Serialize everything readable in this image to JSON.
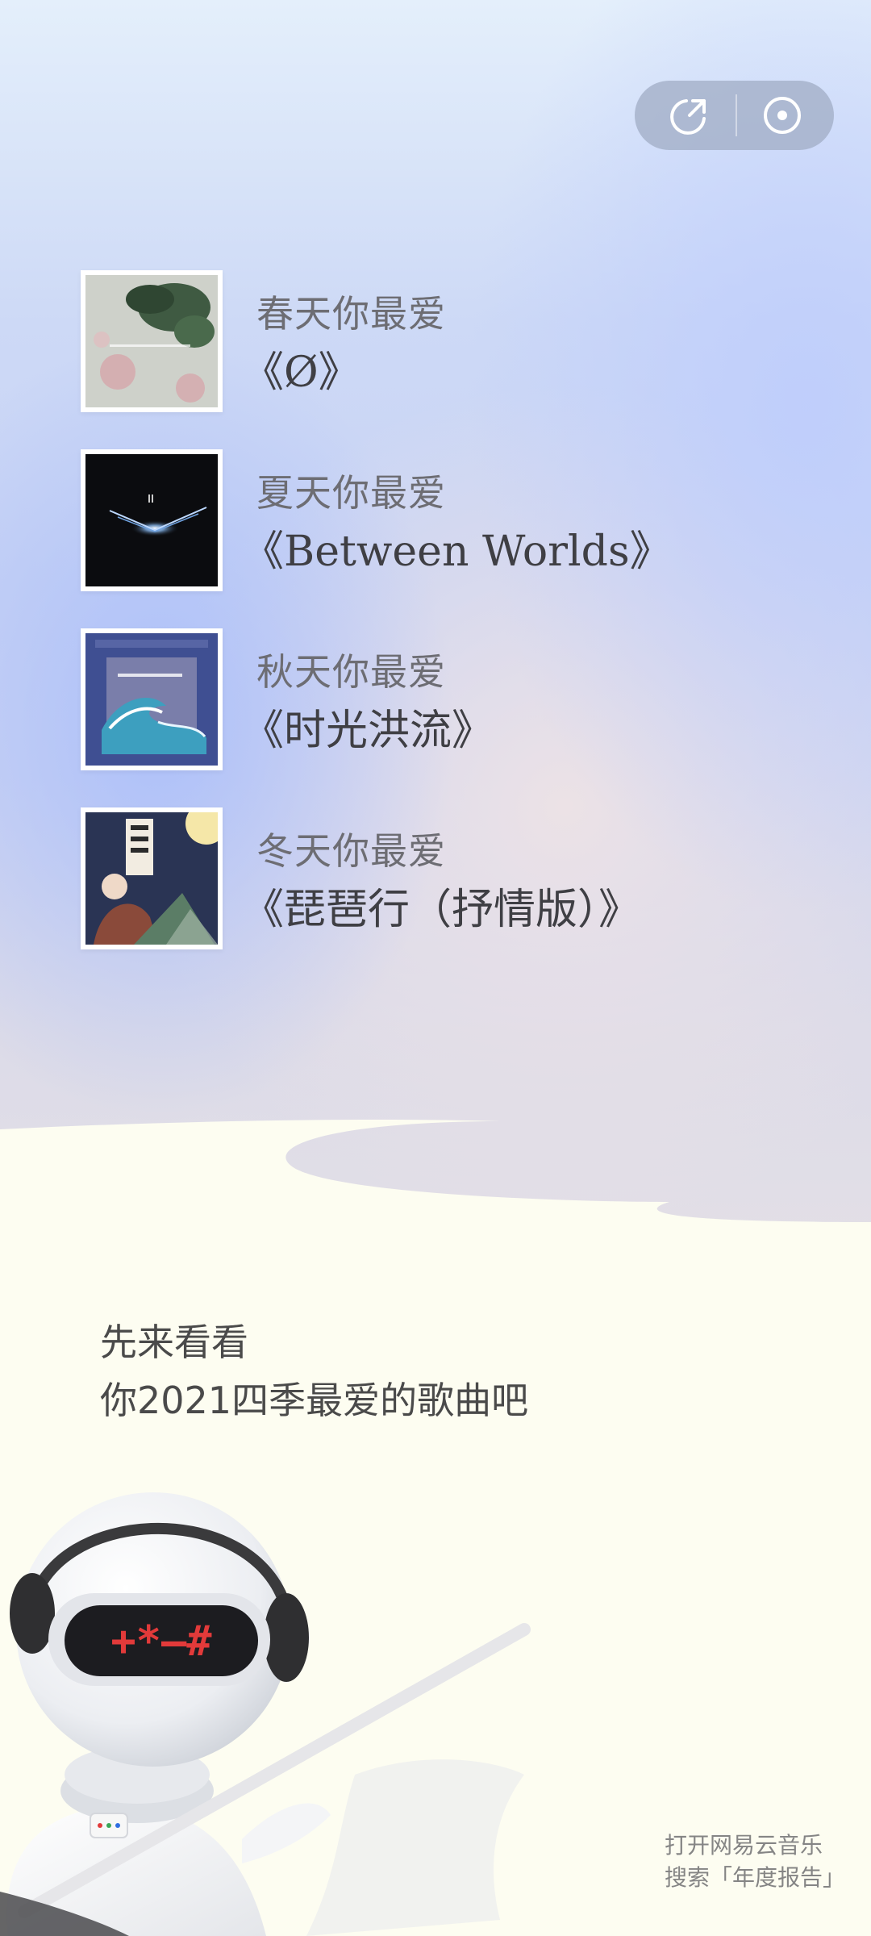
{
  "capsule": {
    "share_icon": "share-arrow-icon",
    "record_icon": "target-dot-icon"
  },
  "songs": [
    {
      "season": "春天你最爱",
      "title": "《Ø》",
      "cover_icon": "album-cover-spring"
    },
    {
      "season": "夏天你最爱",
      "title": "《Between Worlds》",
      "cover_icon": "album-cover-summer"
    },
    {
      "season": "秋天你最爱",
      "title": "《时光洪流》",
      "cover_icon": "album-cover-autumn"
    },
    {
      "season": "冬天你最爱",
      "title": "《琵琶行（抒情版）》",
      "cover_icon": "album-cover-winter"
    }
  ],
  "intro": {
    "line1": "先来看看",
    "line2": "你2021四季最爱的歌曲吧"
  },
  "footer": {
    "line1": "打开网易云音乐",
    "line2": "搜索「年度报告」"
  },
  "robot": {
    "visor_text": "+*—#"
  },
  "colors": {
    "cream": "#fdfdf1",
    "capsule": "#a0acc4",
    "text_dark": "#3f3f44",
    "visor_red": "#e23a3a"
  }
}
